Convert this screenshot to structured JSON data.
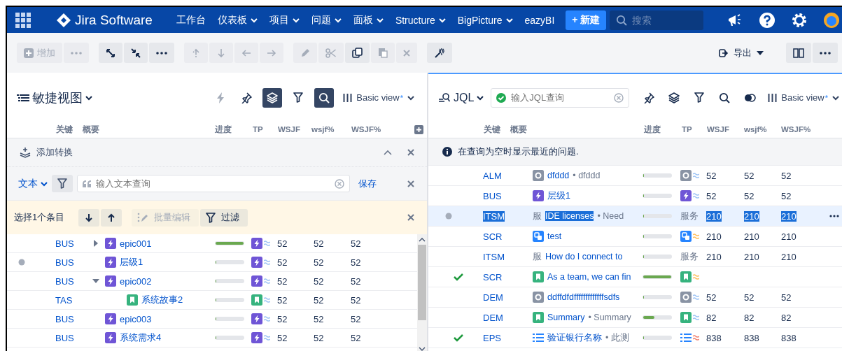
{
  "nav": {
    "logo": "Jira Software",
    "items": [
      {
        "label": "工作台",
        "dropdown": false
      },
      {
        "label": "仪表板",
        "dropdown": true
      },
      {
        "label": "项目",
        "dropdown": true
      },
      {
        "label": "问题",
        "dropdown": true
      },
      {
        "label": "面板",
        "dropdown": true
      },
      {
        "label": "Structure",
        "dropdown": true
      },
      {
        "label": "BigPicture",
        "dropdown": true
      },
      {
        "label": "eazyBI",
        "dropdown": false
      }
    ],
    "create_button": "+ 新建",
    "search": {
      "placeholder": "搜索"
    }
  },
  "toolbar": {
    "groups": [
      {
        "buttons": [
          {
            "label": "增加",
            "disabled": true
          },
          {
            "disabled": true
          }
        ]
      },
      {
        "buttons": [
          {
            "disabled": false
          },
          {
            "disabled": false
          },
          {
            "disabled": false
          }
        ]
      },
      {
        "buttons": [
          {
            "disabled": true
          },
          {
            "disabled": true
          },
          {
            "disabled": true
          },
          {
            "disabled": true
          }
        ]
      },
      {
        "buttons": [
          {
            "disabled": true
          },
          {
            "disabled": true
          },
          {
            "disabled": false
          },
          {
            "disabled": true
          },
          {
            "disabled": true
          }
        ]
      },
      {
        "buttons": [
          {
            "disabled": false
          }
        ]
      }
    ],
    "export": "导出"
  },
  "left_panel": {
    "title": "敏捷视图",
    "tools": [
      {
        "disabled": true,
        "active": false
      },
      {
        "disabled": false,
        "active": false
      },
      {
        "disabled": false,
        "active": true
      },
      {
        "disabled": false,
        "active": false
      },
      {
        "disabled": false,
        "active": true
      }
    ],
    "view": {
      "label": "Basic view",
      "modified": "*"
    },
    "columns": [
      "关键",
      "概要",
      "进度",
      "TP",
      "WSJF",
      "wsjf%",
      "WSJF%"
    ],
    "transform": {
      "label": "添加转换"
    },
    "filter": {
      "mode": "文本",
      "placeholder": "输入文本查询",
      "save": "保存"
    },
    "selection": {
      "label": "选择1个条目",
      "bulk_edit": {
        "label": "批量编辑",
        "disabled": true
      },
      "filter_button": "过滤"
    },
    "rows": [
      {
        "key": "BUS",
        "kind": "epic",
        "summary": "epic001",
        "expanded": false,
        "dot": false,
        "done": false,
        "level": 1,
        "color": "#9cc3f5",
        "values": [
          "52",
          "52",
          "52"
        ]
      },
      {
        "key": "BUS",
        "kind": "epic",
        "summary": "层级1",
        "dot": true,
        "done": false,
        "level": 0,
        "color": "#9cc3f5",
        "values": [
          "52",
          "52",
          "52"
        ]
      },
      {
        "key": "BUS",
        "kind": "epic",
        "summary": "epic002",
        "expanded": true,
        "dot": false,
        "done": false,
        "level": 0,
        "color": "#9cc3f5",
        "values": [
          "52",
          "52",
          "52"
        ],
        "children": [
          {
            "key": "TAS",
            "kind": "story",
            "summary": "系统故事2",
            "dot": false,
            "done": false,
            "level": 0,
            "color": "#9cc3f5",
            "values": [
              "52",
              "52",
              "52"
            ]
          }
        ]
      },
      {
        "key": "BUS",
        "kind": "epic",
        "summary": "epic003",
        "dot": false,
        "done": false,
        "level": 0,
        "color": "#9cc3f5",
        "values": [
          "52",
          "52",
          "52"
        ]
      },
      {
        "key": "BUS",
        "kind": "epic",
        "summary": "系统需求4",
        "dot": false,
        "done": false,
        "level": 0,
        "color": "#9cc3f5",
        "values": [
          "52",
          "52",
          "52"
        ]
      }
    ]
  },
  "right_panel": {
    "jql": {
      "label": "JQL",
      "placeholder": "输入JQL查询",
      "valid": true
    },
    "tools": [
      {
        "disabled": false,
        "active": false
      },
      {
        "disabled": false,
        "active": false
      },
      {
        "disabled": false,
        "active": false
      },
      {
        "disabled": false,
        "active": false
      },
      {
        "disabled": false,
        "active": false
      }
    ],
    "view": {
      "label": "Basic view",
      "modified": "*"
    },
    "columns": [
      "关键",
      "概要",
      "进度",
      "TP",
      "WSJF",
      "wsjf%",
      "WSJF%"
    ],
    "info": "在查询为空时显示最近的问题.",
    "rows": [
      {
        "key": "ALM",
        "kind": "other",
        "summary": "dfddd",
        "detail": "• dfddd",
        "dot": false,
        "done": false,
        "level": 0,
        "color": "#9cc3f5",
        "values": [
          "52",
          "52",
          "52"
        ],
        "selected": false
      },
      {
        "key": "BUS",
        "kind": "epic",
        "summary": "层级1",
        "dot": false,
        "done": false,
        "level": 0,
        "color": "#9cc3f5",
        "values": [
          "52",
          "52",
          "52"
        ],
        "selected": false
      },
      {
        "key": "ITSM",
        "kind": "service",
        "prefix": "服",
        "summary": "IDE licenses",
        "detail": "• Need",
        "tp_text": "服务",
        "dot": true,
        "done": false,
        "level": 0,
        "values": [
          "210",
          "210",
          "210"
        ],
        "selected": true
      },
      {
        "key": "SCR",
        "kind": "subtask",
        "summary": "test",
        "dot": false,
        "done": false,
        "level": 0,
        "color": "#ffbd59",
        "values": [
          "210",
          "210",
          "210"
        ],
        "selected": false
      },
      {
        "key": "ITSM",
        "kind": "service",
        "prefix": "服",
        "summary": "How do I connect to",
        "tp_text": "服务",
        "dot": false,
        "done": false,
        "level": 0,
        "values": [
          "210",
          "210",
          "210"
        ],
        "selected": false
      },
      {
        "key": "SCR",
        "kind": "story",
        "summary": "As a team, we can fin",
        "dot": false,
        "done": true,
        "level": 1,
        "color": "#ffbd59",
        "selected": false
      },
      {
        "key": "DEM",
        "kind": "other",
        "summary": "ddffdfdfffffffffffffsdfs",
        "dot": false,
        "done": false,
        "level": 0,
        "color": "#9cc3f5",
        "values": [
          "52",
          "52",
          "52"
        ],
        "selected": false
      },
      {
        "key": "DEM",
        "kind": "story",
        "summary": "Summary",
        "detail": "• Summary",
        "dot": false,
        "done": false,
        "level": 0.4,
        "color": "#9cc3f5",
        "values": [
          "82",
          "82",
          "82"
        ],
        "selected": false
      },
      {
        "key": "EPS",
        "kind": "list",
        "summary": "验证银行名称",
        "detail": "• 此测",
        "dot": false,
        "done": true,
        "level": 0,
        "color": "#f08070",
        "values": [
          "838",
          "838",
          "838"
        ],
        "selected": false
      }
    ]
  }
}
